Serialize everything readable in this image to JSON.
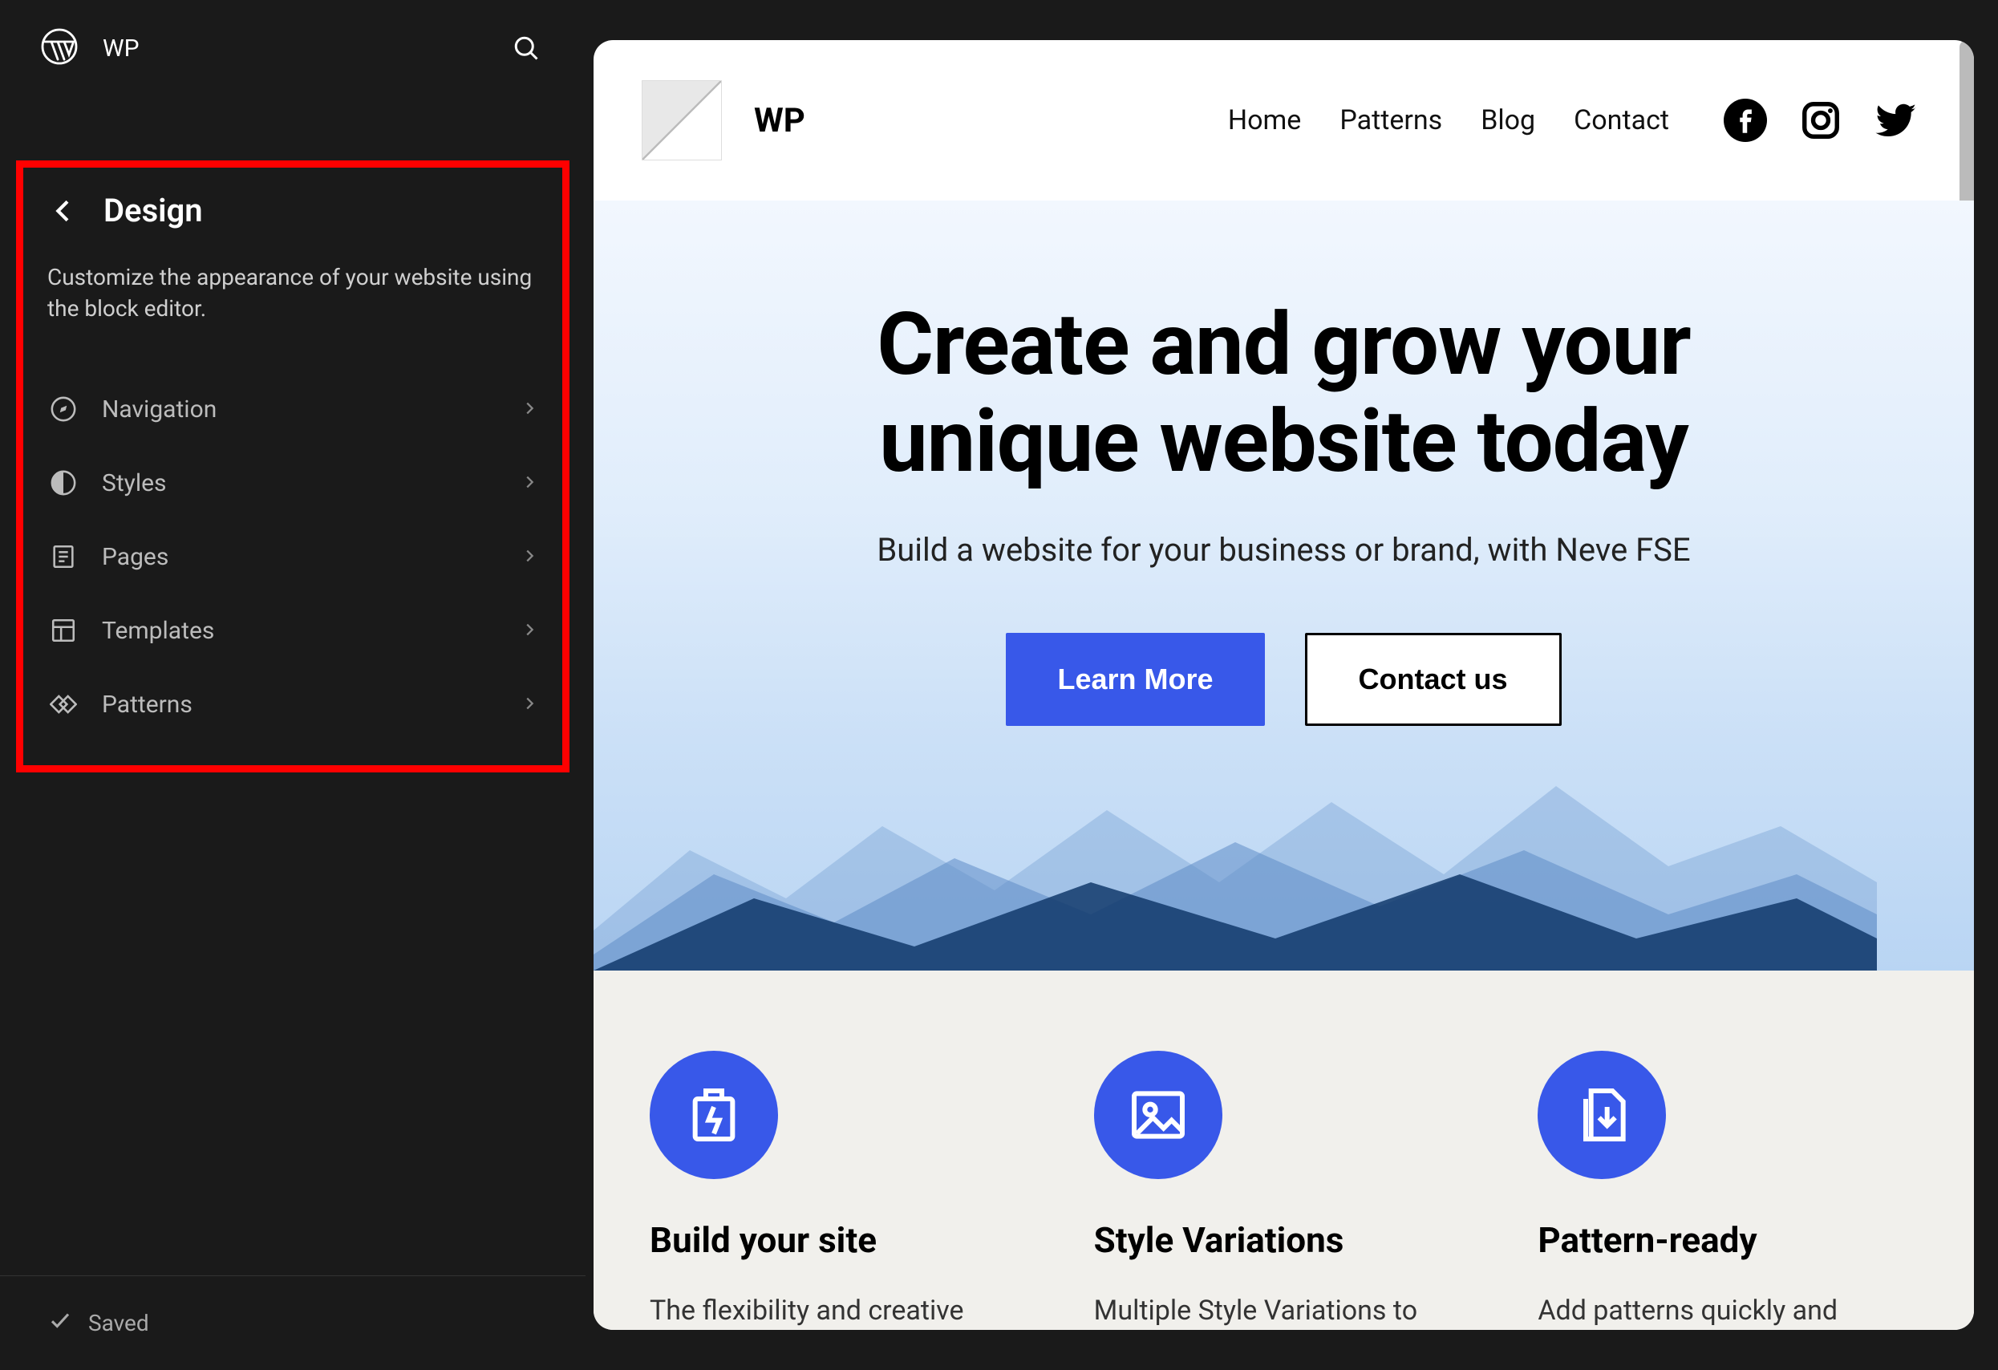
{
  "sidebar": {
    "site_name": "WP",
    "panel_title": "Design",
    "panel_desc": "Customize the appearance of your website using the block editor.",
    "items": [
      {
        "label": "Navigation"
      },
      {
        "label": "Styles"
      },
      {
        "label": "Pages"
      },
      {
        "label": "Templates"
      },
      {
        "label": "Patterns"
      }
    ],
    "saved_label": "Saved"
  },
  "preview": {
    "brand": "WP",
    "nav": [
      "Home",
      "Patterns",
      "Blog",
      "Contact"
    ],
    "hero": {
      "title_line1": "Create and grow your",
      "title_line2": "unique website today",
      "subtitle": "Build a website for your business or brand, with Neve FSE",
      "cta_primary": "Learn More",
      "cta_secondary": "Contact us"
    },
    "features": [
      {
        "title": "Build your site",
        "desc": "The flexibility and creative"
      },
      {
        "title": "Style Variations",
        "desc": "Multiple Style Variations to"
      },
      {
        "title": "Pattern-ready",
        "desc": "Add patterns quickly and"
      }
    ]
  }
}
